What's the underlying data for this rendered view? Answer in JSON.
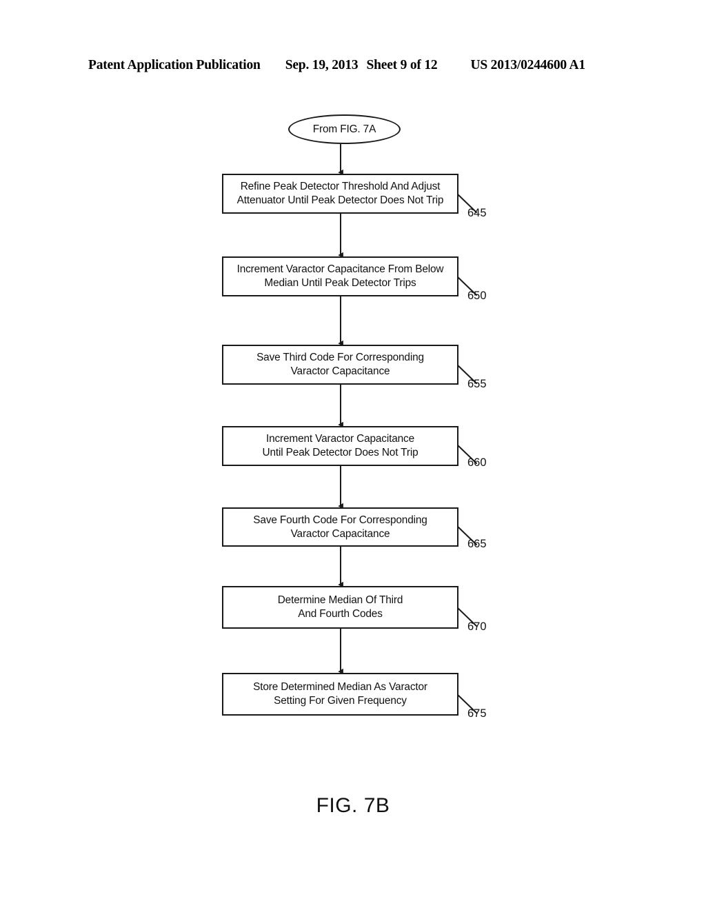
{
  "header": {
    "publication": "Patent Application Publication",
    "date": "Sep. 19, 2013",
    "sheet": "Sheet 9 of 12",
    "patent_number": "US 2013/0244600 A1"
  },
  "figure": {
    "caption": "FIG. 7B"
  },
  "flowchart": {
    "entry": {
      "label": "From FIG. 7A",
      "shape": "oval"
    },
    "steps": [
      {
        "ref": "645",
        "text": "Refine Peak Detector Threshold And Adjust\nAttenuator Until Peak Detector Does Not Trip"
      },
      {
        "ref": "650",
        "text": "Increment Varactor Capacitance From Below\nMedian Until Peak Detector Trips"
      },
      {
        "ref": "655",
        "text": "Save Third Code For Corresponding\nVaractor Capacitance"
      },
      {
        "ref": "660",
        "text": "Increment Varactor Capacitance\nUntil Peak Detector Does Not Trip"
      },
      {
        "ref": "665",
        "text": "Save Fourth Code For Corresponding\nVaractor Capacitance"
      },
      {
        "ref": "670",
        "text": "Determine Median Of Third\nAnd Fourth Codes"
      },
      {
        "ref": "675",
        "text": "Store Determined Median As Varactor\nSetting For Given Frequency"
      }
    ]
  },
  "colors": {
    "ink": "#111111",
    "stroke": "#1a1a1a",
    "paper": "#ffffff"
  }
}
